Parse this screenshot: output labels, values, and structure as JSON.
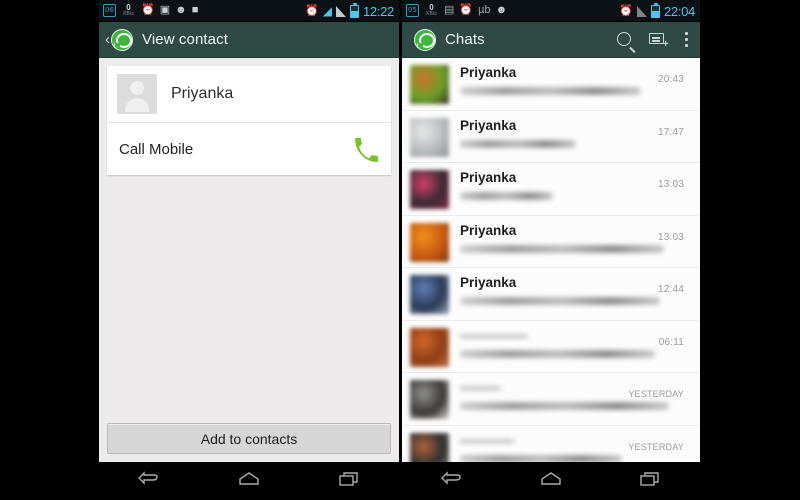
{
  "left_phone": {
    "status_bar": {
      "calendar_day": "06",
      "data_rate_value": "0",
      "data_rate_unit": "KB/s",
      "icons": [
        "calendar-icon",
        "data-rate-icon",
        "alarm-clock-icon",
        "gallery-icon",
        "android-icon",
        "play-store-icon"
      ],
      "right_icons": [
        "alarm-icon",
        "wifi-icon",
        "signal-icon",
        "battery-icon"
      ],
      "time": "12:22"
    },
    "action_bar": {
      "back_label": "‹",
      "logo": "whatsapp-logo",
      "title": "View contact"
    },
    "contact_card": {
      "avatar": "placeholder-avatar",
      "name": "Priyanka",
      "call_label": "Call Mobile",
      "call_icon": "phone-icon",
      "call_icon_color": "#76c327"
    },
    "add_button_label": "Add to contacts"
  },
  "right_phone": {
    "status_bar": {
      "calendar_day": "05",
      "data_rate_value": "0",
      "data_rate_unit": "KB/s",
      "icons": [
        "calendar-icon",
        "data-rate-icon",
        "battery-saver-icon",
        "alarm-clock-icon",
        "ub-icon",
        "android-icon"
      ],
      "right_icons": [
        "alarm-icon",
        "signal-icon",
        "battery-icon"
      ],
      "time": "22:04"
    },
    "action_bar": {
      "logo": "whatsapp-logo",
      "title": "Chats",
      "actions": [
        "search-icon",
        "new-chat-icon",
        "overflow-menu-icon"
      ]
    },
    "chats": [
      {
        "name": "Priyanka",
        "time": "20:43",
        "name_blurred": false,
        "avatar_colors": [
          "#c9752a",
          "#6aa02a",
          "#3f3020"
        ],
        "msg_width": 78
      },
      {
        "name": "Priyanka",
        "time": "17:47",
        "name_blurred": false,
        "avatar_colors": [
          "#e8e8e8",
          "#b9bcbe",
          "#8f9396"
        ],
        "msg_width": 50
      },
      {
        "name": "Priyanka",
        "time": "13:03",
        "name_blurred": false,
        "avatar_colors": [
          "#d2406a",
          "#3a2b33",
          "#8d2b48"
        ],
        "msg_width": 40
      },
      {
        "name": "Priyanka",
        "time": "13:03",
        "name_blurred": false,
        "avatar_colors": [
          "#f0901b",
          "#c85a12",
          "#7a3b0d"
        ],
        "msg_width": 88
      },
      {
        "name": "Priyanka",
        "time": "12:44",
        "name_blurred": false,
        "avatar_colors": [
          "#5e7fb8",
          "#2b3a55",
          "#9aa7bd"
        ],
        "msg_width": 86
      },
      {
        "name": "—————",
        "time": "06:11",
        "name_blurred": true,
        "avatar_colors": [
          "#d0682a",
          "#8e3d15",
          "#c0764a"
        ],
        "msg_width": 84
      },
      {
        "name": "———",
        "time": "YESTERDAY",
        "name_blurred": true,
        "avatar_colors": [
          "#8f8f8f",
          "#3c3a38",
          "#d9d6d2"
        ],
        "msg_width": 90
      },
      {
        "name": "————",
        "time": "YESTERDAY",
        "name_blurred": true,
        "avatar_colors": [
          "#b0633b",
          "#2f2f33",
          "#7d8f6a"
        ],
        "msg_width": 70
      }
    ]
  },
  "nav_bar": {
    "buttons": [
      "back-button",
      "home-button",
      "recents-button"
    ]
  },
  "colors": {
    "action_bar": "#2f4a44",
    "status_bar": "#0b1114",
    "accent_green": "#3fb540",
    "phone_green": "#76c327",
    "page_background": "#eceaea"
  }
}
